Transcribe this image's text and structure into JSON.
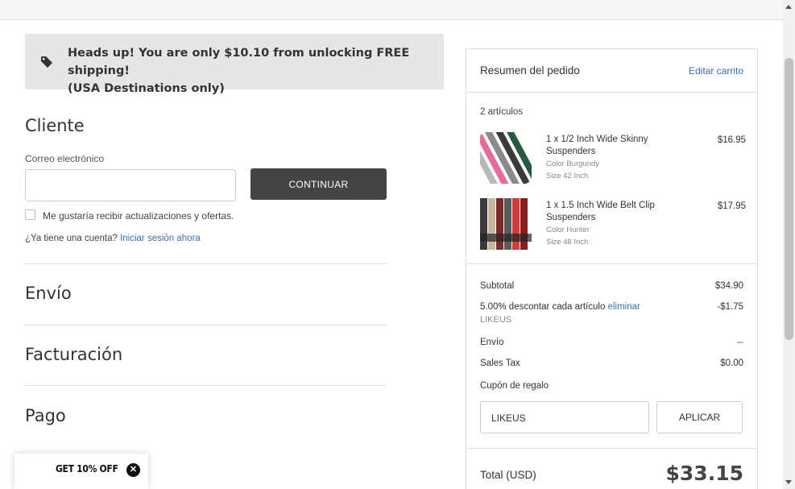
{
  "banner": {
    "line1": "Heads up! You are only $10.10 from unlocking FREE shipping!",
    "line2": "(USA Destinations only)"
  },
  "checkout": {
    "customer_title": "Cliente",
    "email_label": "Correo electrónico",
    "email_value": "",
    "continue_label": "CONTINUAR",
    "newsletter_label": "Me gustaría recibir actualizaciones y ofertas.",
    "account_question": "¿Ya tiene una cuenta?",
    "login_link": "Iniciar sesión ahora",
    "shipping_title": "Envío",
    "billing_title": "Facturación",
    "payment_title": "Pago"
  },
  "popup": {
    "text": "GET 10% OFF",
    "close_icon": "close-icon"
  },
  "summary": {
    "title": "Resumen del pedido",
    "edit_link": "Editar carrito",
    "items_count": "2 artículos",
    "items": [
      {
        "name": "1 x 1/2 Inch Wide Skinny Suspenders",
        "color": "Color Burgundy",
        "size": "Size 42 Inch",
        "price": "$16.95"
      },
      {
        "name": "1 x 1.5 Inch Wide Belt Clip Suspenders",
        "color": "Color Hunter",
        "size": "Size 48 Inch",
        "price": "$17.95"
      }
    ],
    "subtotal_label": "Subtotal",
    "subtotal_value": "$34.90",
    "discount_label": "5.00% descontar cada artículo",
    "discount_remove": "eliminar",
    "discount_value": "-$1.75",
    "coupon_code": "LIKEUS",
    "shipping_label": "Envío",
    "shipping_value": "--",
    "tax_label": "Sales Tax",
    "tax_value": "$0.00",
    "gift_label": "Cupón de regalo",
    "gift_value": "LIKEUS",
    "apply_label": "APLICAR",
    "total_label": "Total (USD)",
    "total_value": "$33.15"
  },
  "colors": {
    "link": "#3a6fb0",
    "button_dark": "#444444",
    "banner_bg": "#e6e6e6"
  }
}
